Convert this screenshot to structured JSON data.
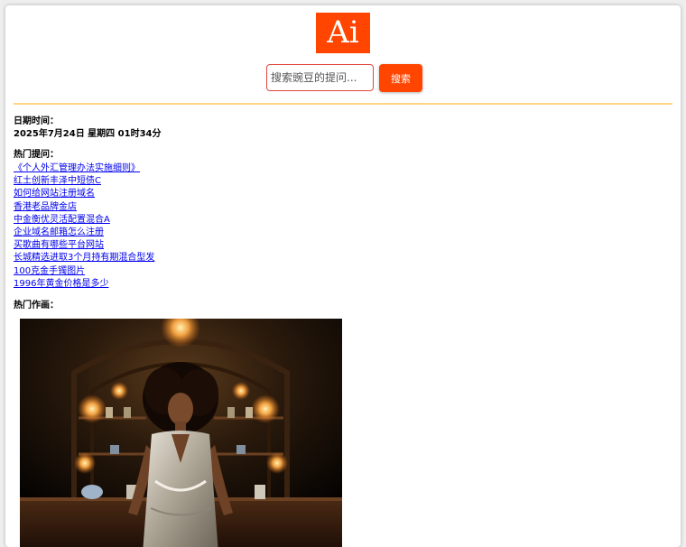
{
  "logo": {
    "text": "Ai",
    "color": "#ff4500"
  },
  "search": {
    "placeholder": "搜索豌豆的提问...",
    "button_label": "搜索"
  },
  "datetime": {
    "label": "日期时间：",
    "value": "2025年7月24日 星期四 01时34分"
  },
  "hot_questions": {
    "label": "热门提问：",
    "items": [
      "《个人外汇管理办法实施细则》",
      "红土创新丰泽中短债C",
      "如何给网站注册域名",
      "香港老品牌金店",
      "中金衡优灵活配置混合A",
      "企业域名邮箱怎么注册",
      "买歌曲有哪些平台网站",
      "长城精选进取3个月持有期混合型发",
      "100克金手镯图片",
      "1996年黄金价格是多少"
    ]
  },
  "hot_artworks": {
    "label": "热门作画："
  },
  "colors": {
    "accent": "#ff4500",
    "divider": "#ffd580",
    "link": "#0000ee"
  }
}
